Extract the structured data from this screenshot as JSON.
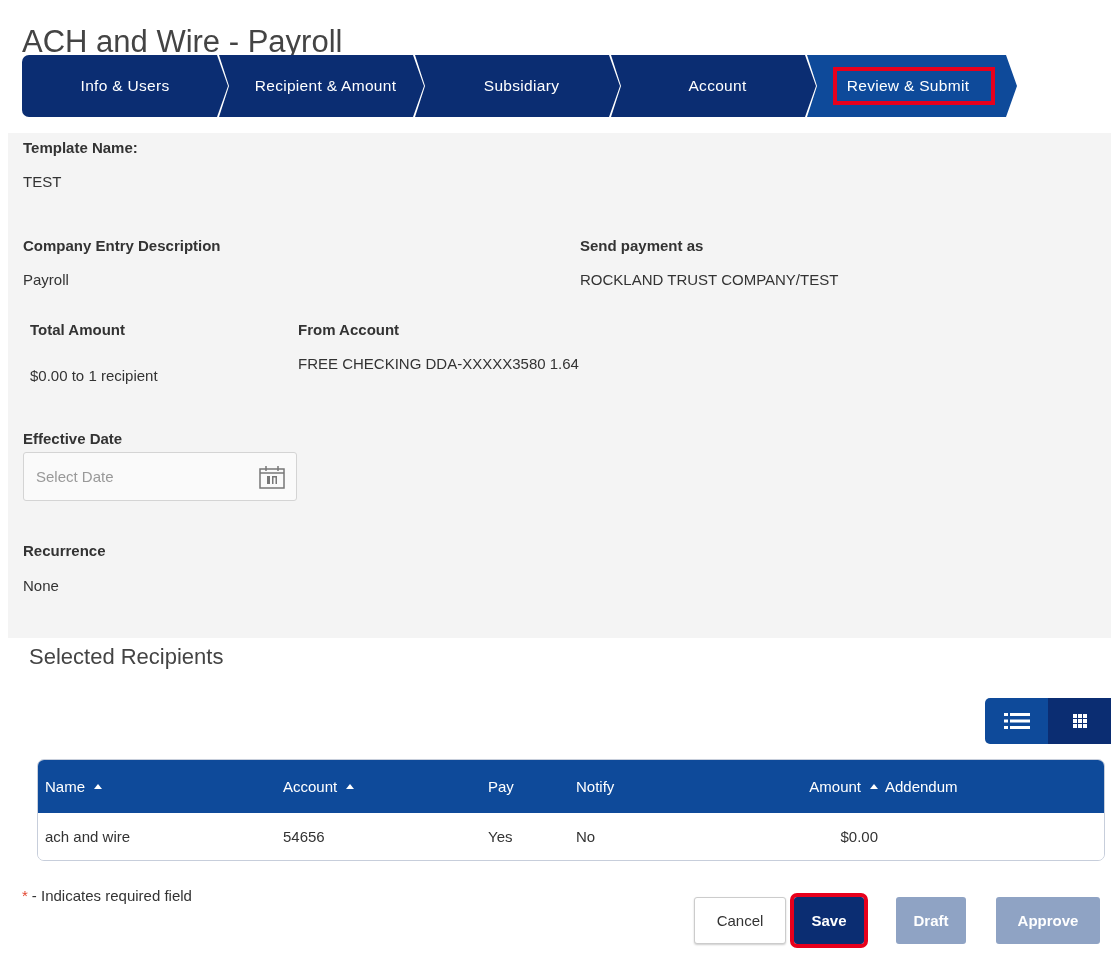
{
  "title": "ACH and Wire - Payroll",
  "steps": [
    {
      "label": "Info & Users",
      "selected": false,
      "highlighted": false
    },
    {
      "label": "Recipient & Amount",
      "selected": false,
      "highlighted": false
    },
    {
      "label": "Subsidiary",
      "selected": false,
      "highlighted": false
    },
    {
      "label": "Account",
      "selected": false,
      "highlighted": false
    },
    {
      "label": "Review & Submit",
      "selected": true,
      "highlighted": true
    }
  ],
  "details": {
    "template_name": {
      "label": "Template Name:",
      "value": "TEST"
    },
    "company_entry_description": {
      "label": "Company Entry Description",
      "value": "Payroll"
    },
    "send_payment_as": {
      "label": "Send payment as",
      "value": "ROCKLAND TRUST COMPANY/TEST"
    },
    "total_amount": {
      "label": "Total Amount",
      "value": "$0.00 to 1 recipient"
    },
    "from_account": {
      "label": "From Account",
      "value": "FREE CHECKING DDA-XXXXX3580 1.64"
    },
    "effective_date": {
      "label": "Effective Date",
      "placeholder": "Select Date"
    },
    "recurrence": {
      "label": "Recurrence",
      "value": "None"
    }
  },
  "recipients": {
    "heading": "Selected Recipients",
    "views": [
      {
        "kind": "list",
        "selected": true
      },
      {
        "kind": "grid",
        "selected": false
      }
    ],
    "columns": [
      {
        "label": "Name",
        "sortable": true,
        "kind": "text"
      },
      {
        "label": "Account",
        "sortable": true,
        "kind": "text"
      },
      {
        "label": "Pay",
        "sortable": false,
        "kind": "text"
      },
      {
        "label": "Notify",
        "sortable": false,
        "kind": "text"
      },
      {
        "label": "Amount",
        "sortable": true,
        "kind": "amount"
      },
      {
        "label": "Addendum",
        "sortable": false,
        "kind": "text"
      }
    ],
    "rows": [
      {
        "cells": [
          "ach and wire",
          "54656",
          "Yes",
          "No",
          "$0.00"
        ]
      }
    ]
  },
  "footer": {
    "required_mark": "*",
    "required_note": "- Indicates required field",
    "buttons": [
      {
        "label": "Cancel",
        "kind": "secondary",
        "disabled": false,
        "highlighted": false
      },
      {
        "label": "Save",
        "kind": "primary",
        "disabled": false,
        "highlighted": true
      },
      {
        "label": "Draft",
        "kind": "primary",
        "disabled": true,
        "highlighted": false
      },
      {
        "label": "Approve",
        "kind": "primary",
        "disabled": true,
        "highlighted": false
      }
    ]
  }
}
